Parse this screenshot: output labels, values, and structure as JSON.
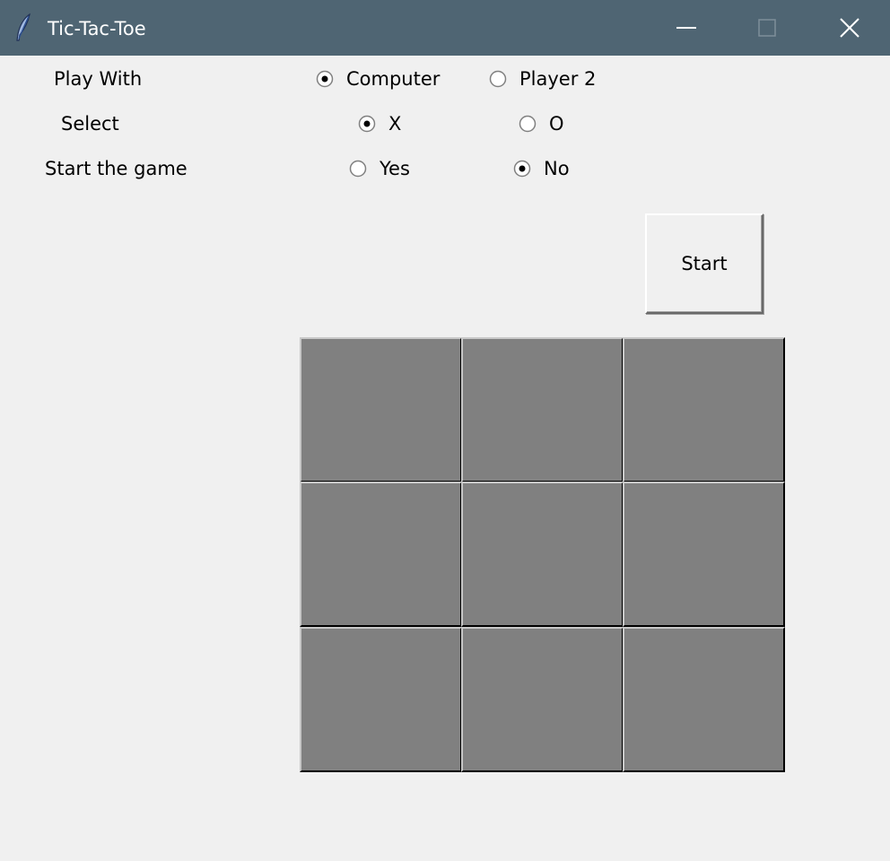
{
  "window": {
    "title": "Tic-Tac-Toe",
    "icon": "feather-icon",
    "controls": [
      "minimize-icon",
      "maximize-icon",
      "close-icon"
    ],
    "titlebar_color": "#4f6573",
    "background_color": "#f0f0f0"
  },
  "settings": {
    "play_with": {
      "label": "Play With",
      "options": [
        {
          "label": "Computer",
          "selected": true
        },
        {
          "label": "Player 2",
          "selected": false
        }
      ]
    },
    "select": {
      "label": "Select",
      "options": [
        {
          "label": "X",
          "selected": true
        },
        {
          "label": "O",
          "selected": false
        }
      ]
    },
    "start_the_game": {
      "label": "Start the game",
      "options": [
        {
          "label": "Yes",
          "selected": false
        },
        {
          "label": "No",
          "selected": true
        }
      ]
    }
  },
  "start_button": {
    "label": "Start"
  },
  "board": {
    "cell_color": "#808080",
    "cells": [
      "",
      "",
      "",
      "",
      "",
      "",
      "",
      "",
      ""
    ]
  }
}
